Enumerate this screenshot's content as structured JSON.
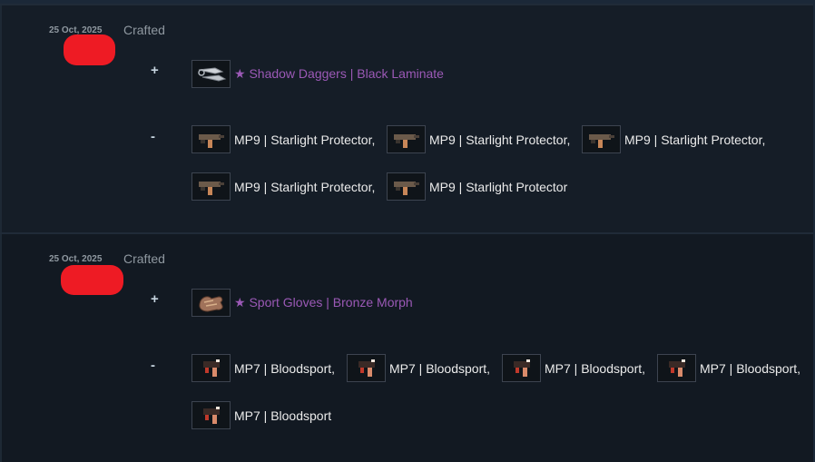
{
  "entries": [
    {
      "date": "25 Oct, 2025",
      "event": "Crafted",
      "plus_sign": "+",
      "minus_sign": "-",
      "received": "★ Shadow Daggers | Black Laminate",
      "given": [
        "MP9 | Starlight Protector,",
        "MP9 | Starlight Protector,",
        "MP9 | Starlight Protector,",
        "MP9 | Starlight Protector,",
        "MP9 | Starlight Protector"
      ]
    },
    {
      "date": "25 Oct, 2025",
      "event": "Crafted",
      "plus_sign": "+",
      "minus_sign": "-",
      "received": "★ Sport Gloves | Bronze Morph",
      "given": [
        "MP7 | Bloodsport,",
        "MP7 | Bloodsport,",
        "MP7 | Bloodsport,",
        "MP7 | Bloodsport,",
        "MP7 | Bloodsport"
      ]
    }
  ],
  "colors": {
    "rare_item": "#9b59b6",
    "redaction": "#ee1b24"
  }
}
